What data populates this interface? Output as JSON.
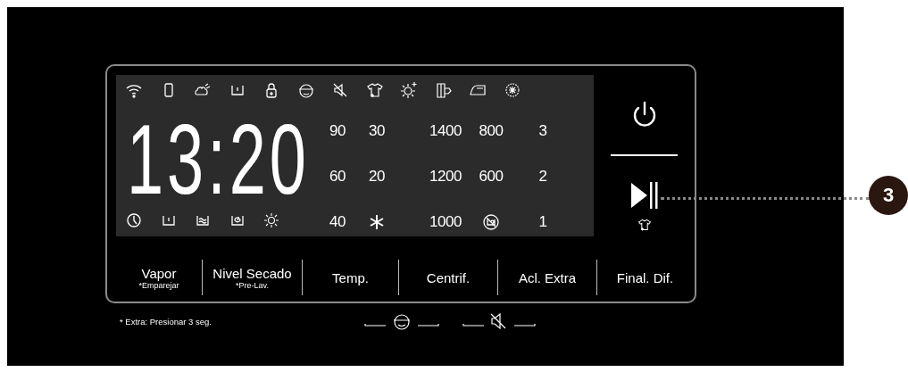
{
  "display": {
    "time": "13:20",
    "columns": [
      {
        "cells": [
          {
            "kind": "text",
            "text": "90"
          },
          {
            "kind": "text",
            "text": "60"
          },
          {
            "kind": "text",
            "text": "40"
          }
        ]
      },
      {
        "cells": [
          {
            "kind": "text",
            "text": "30"
          },
          {
            "kind": "text",
            "text": "20"
          },
          {
            "kind": "snowflake"
          }
        ]
      },
      {
        "cells": [
          {
            "kind": "text",
            "text": "1400"
          },
          {
            "kind": "text",
            "text": "1200"
          },
          {
            "kind": "text",
            "text": "1000"
          }
        ]
      },
      {
        "cells": [
          {
            "kind": "text",
            "text": "800"
          },
          {
            "kind": "text",
            "text": "600"
          },
          {
            "kind": "no-spin"
          }
        ]
      },
      {
        "cells": [
          {
            "kind": "text",
            "text": "3"
          },
          {
            "kind": "text",
            "text": "2"
          },
          {
            "kind": "text",
            "text": "1"
          }
        ]
      }
    ]
  },
  "buttons": [
    {
      "label": "Vapor",
      "sub": "*Emparejar"
    },
    {
      "label": "Nivel Secado",
      "sub": "*Pre-Lav."
    },
    {
      "label": "Temp."
    },
    {
      "label": "Centrif."
    },
    {
      "label": "Acl. Extra"
    },
    {
      "label": "Final. Dif."
    }
  ],
  "footnote": "* Extra: Presionar 3 seg.",
  "callout": "3"
}
